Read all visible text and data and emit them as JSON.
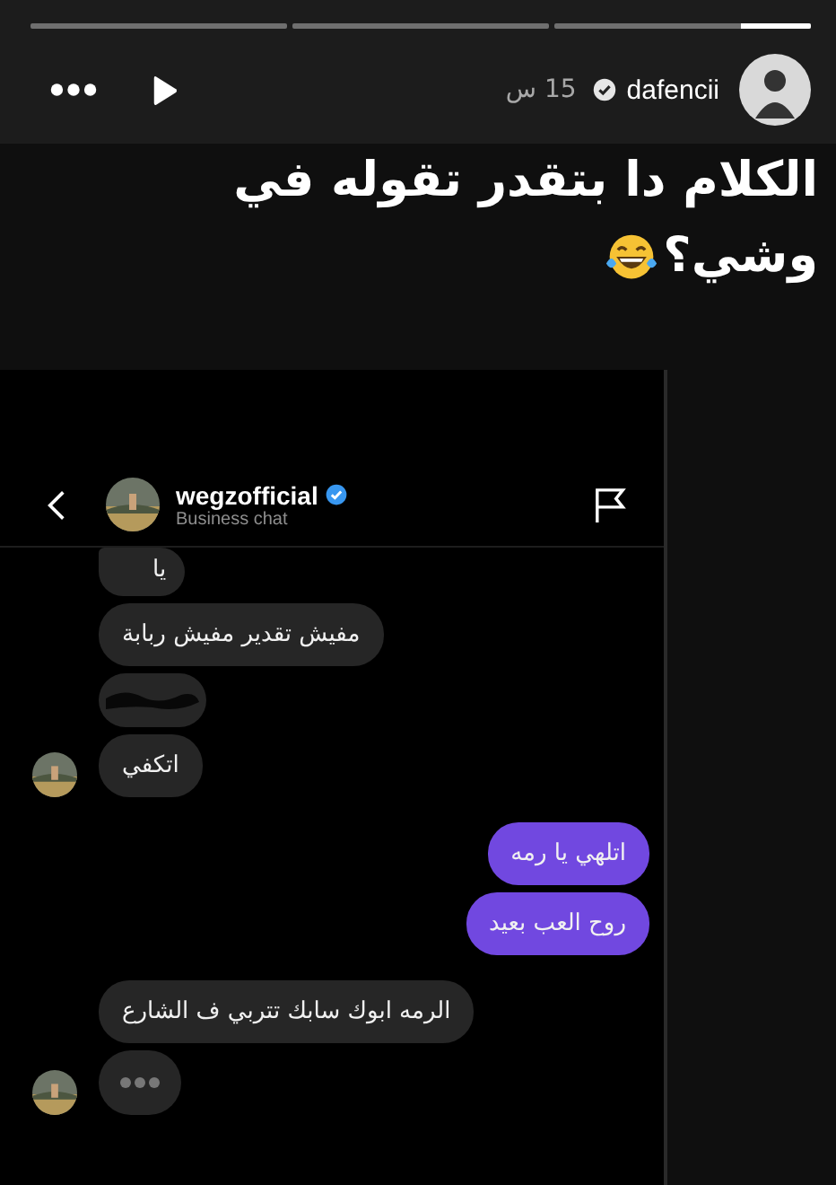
{
  "progress": [
    {
      "current": true,
      "level": 0.27
    },
    {
      "current": false
    },
    {
      "current": false
    }
  ],
  "story_header": {
    "username": "dafencii",
    "verified": true,
    "time": "15 س"
  },
  "caption_lines": [
    "الكلام دا بتقدر تقوله في",
    "وشي؟"
  ],
  "chat": {
    "contact": "wegzofficial",
    "verified": true,
    "subtitle": "Business chat",
    "messages": [
      {
        "outgoing": false,
        "kind": "redacted",
        "text": "يا",
        "avatar": false
      },
      {
        "outgoing": false,
        "kind": "text",
        "text": "مفيش تقدير مفيش ربابة",
        "avatar": false
      },
      {
        "outgoing": false,
        "kind": "scribble",
        "avatar": false
      },
      {
        "outgoing": false,
        "kind": "text",
        "text": "اتكفي",
        "avatar": true
      },
      {
        "outgoing": true,
        "kind": "text",
        "text": "اتلهي يا رمه"
      },
      {
        "outgoing": true,
        "kind": "text",
        "text": "روح العب بعيد"
      },
      {
        "outgoing": false,
        "kind": "text",
        "text": "الرمه ابوك سابك تتربي ف الشارع",
        "avatar": false
      },
      {
        "outgoing": false,
        "kind": "typing",
        "avatar": true
      }
    ]
  }
}
